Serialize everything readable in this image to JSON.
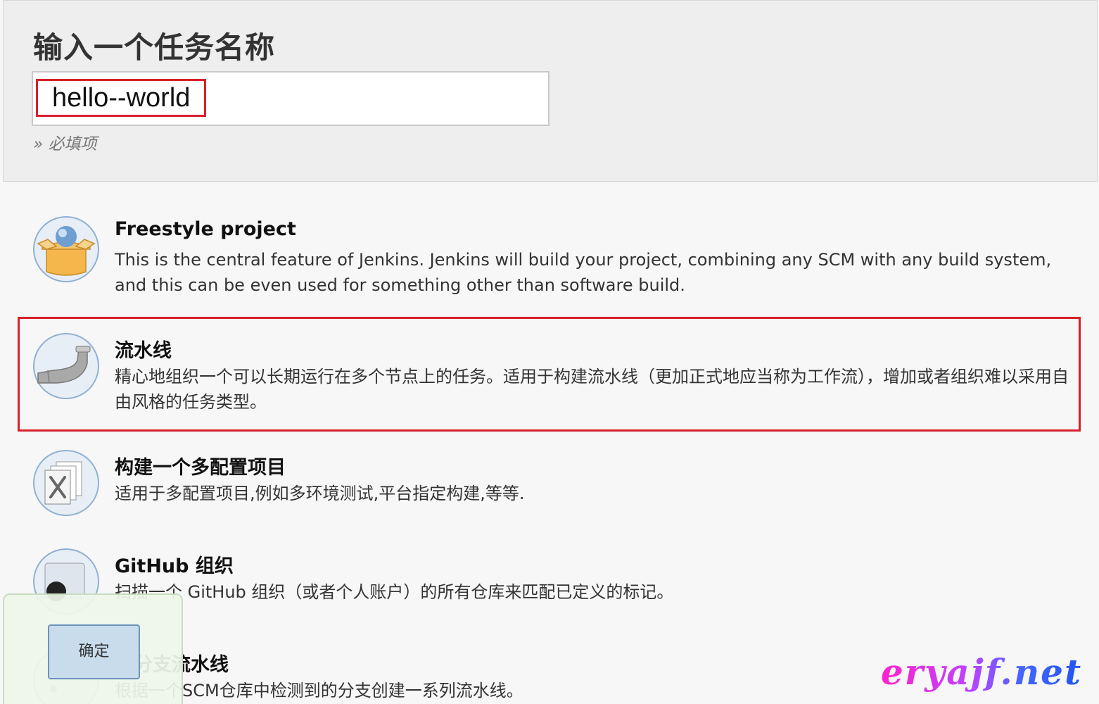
{
  "header": {
    "title": "输入一个任务名称",
    "input_value": "hello--world",
    "required_hint": "» 必填项"
  },
  "items": [
    {
      "title": "Freestyle project",
      "desc": "This is the central feature of Jenkins. Jenkins will build your project, combining any SCM with any build system, and this can be even used for something other than software build."
    },
    {
      "title": "流水线",
      "desc": "精心地组织一个可以长期运行在多个节点上的任务。适用于构建流水线（更加正式地应当称为工作流），增加或者组织难以采用自由风格的任务类型。"
    },
    {
      "title": "构建一个多配置项目",
      "desc": "适用于多配置项目,例如多环境测试,平台指定构建,等等."
    },
    {
      "title": "GitHub 组织",
      "desc": "扫描一个 GitHub 组织（或者个人账户）的所有仓库来匹配已定义的标记。"
    },
    {
      "title": "多分支流水线",
      "desc": "根据一个SCM仓库中检测到的分支创建一系列流水线。"
    }
  ],
  "ok_button": "确定",
  "watermark": "eryajf.net",
  "colors": {
    "highlight": "#d8202a",
    "header_bg": "#eeeeee",
    "button_bg": "#c8dcec"
  }
}
